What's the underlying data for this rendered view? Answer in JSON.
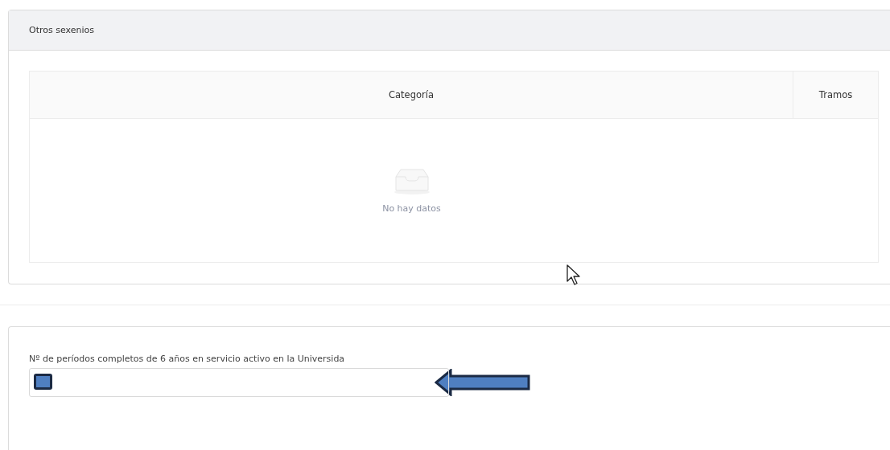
{
  "panel": {
    "title": "Otros sexenios"
  },
  "table": {
    "columns": [
      {
        "label": "Categoría"
      },
      {
        "label": "Tramos"
      }
    ],
    "empty_text": "No hay datos"
  },
  "form": {
    "label": "Nº de períodos completos de 6 años en servicio activo en la Universida"
  }
}
